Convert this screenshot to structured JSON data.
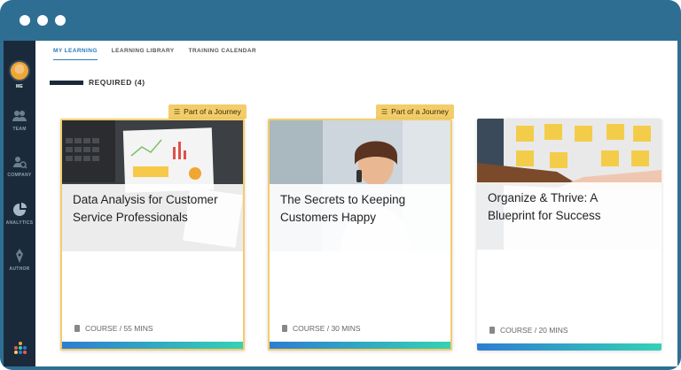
{
  "window": {
    "dots": [
      "red",
      "yellow",
      "green"
    ]
  },
  "sidebar": {
    "items": [
      {
        "label": "ME",
        "icon": "avatar"
      },
      {
        "label": "TEAM",
        "icon": "team-icon"
      },
      {
        "label": "COMPANY",
        "icon": "company-icon"
      },
      {
        "label": "ANALYTICS",
        "icon": "analytics-icon"
      },
      {
        "label": "AUTHOR",
        "icon": "author-icon"
      }
    ]
  },
  "tabs": [
    {
      "label": "MY LEARNING"
    },
    {
      "label": "LEARNING LIBRARY"
    },
    {
      "label": "TRAINING CALENDAR"
    }
  ],
  "section": {
    "title": "REQUIRED (4)"
  },
  "cards": [
    {
      "title": "Data Analysis for Customer Service Professionals",
      "meta": "COURSE / 55 MINS",
      "badge": "Part of a Journey"
    },
    {
      "title": "The Secrets to Keeping Customers Happy",
      "meta": "COURSE / 30 MINS",
      "badge": "Part of a Journey"
    },
    {
      "title": "Organize & Thrive: A Blueprint for Success",
      "meta": "COURSE / 20 MINS"
    }
  ],
  "colors": {
    "accent": "#2b7bb9",
    "badge": "#f3cd6a",
    "sidebar": "#1b2a3a",
    "frame": "#2e6e93"
  }
}
